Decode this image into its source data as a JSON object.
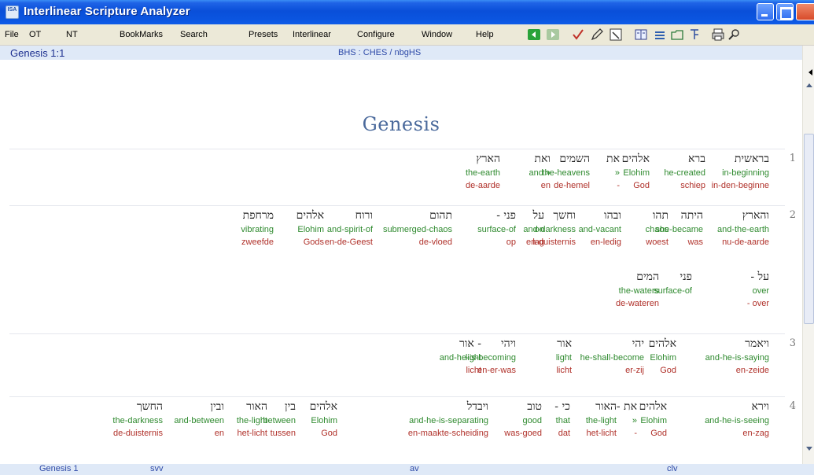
{
  "window": {
    "title": "Interlinear Scripture Analyzer",
    "icon_text": "ISA",
    "controls": [
      "minimize",
      "maximize",
      "close"
    ]
  },
  "menu": [
    "File",
    "OT",
    "NT",
    "BookMarks",
    "Search",
    "Presets",
    "Interlinear",
    "Configure",
    "Window",
    "Help"
  ],
  "toolbar_icons": [
    "back-arrow-icon",
    "forward-arrow-icon",
    "checkmark-icon",
    "pen-icon",
    "edit-page-icon",
    "columns-icon",
    "list-icon",
    "folder-icon",
    "tree-icon",
    "print-icon",
    "search-icon"
  ],
  "header": {
    "reference": "Genesis 1:1",
    "texts": "BHS : CHES / nbgHS"
  },
  "book_title": "Genesis",
  "verses": [
    {
      "num": "1",
      "lines": [
        [
          {
            "heb": "בראשית",
            "eng": "in-beginning",
            "dut": "in-den-beginne"
          },
          {
            "heb": "ברא",
            "eng": "he-created",
            "dut": "schiep"
          },
          {
            "heb": "אלהים",
            "eng": "Elohim",
            "dut": "God"
          },
          {
            "heb": "את",
            "eng": "»",
            "dut": "-"
          },
          {
            "heb": "השמים",
            "eng": "the-heavens",
            "dut": "de-hemel"
          },
          {
            "heb": "ואת",
            "eng": "and »",
            "dut": "en"
          },
          {
            "heb": "הארץ",
            "eng": "the-earth",
            "dut": "de-aarde"
          }
        ]
      ]
    },
    {
      "num": "2",
      "lines": [
        [
          {
            "heb": "והארץ",
            "eng": "and-the-earth",
            "dut": "nu-de-aarde"
          },
          {
            "heb": "היתה",
            "eng": "she-became",
            "dut": "was"
          },
          {
            "heb": "תהו",
            "eng": "chaos",
            "dut": "woest"
          },
          {
            "heb": "ובהו",
            "eng": "and-vacant",
            "dut": "en-ledig"
          },
          {
            "heb": "וחשך",
            "eng": "and-darkness",
            "dut": "en-duisternis"
          },
          {
            "heb": "על",
            "eng": "on",
            "dut": "lag"
          },
          {
            "heb": "פני -",
            "eng": "surface-of",
            "dut": "op"
          },
          {
            "heb": "תהום",
            "eng": "submerged-chaos",
            "dut": "de-vloed"
          },
          {
            "heb": "ורוח",
            "eng": "and-spirit-of",
            "dut": "en-de-Geest"
          },
          {
            "heb": "אלהים",
            "eng": "Elohim",
            "dut": "Gods"
          },
          {
            "heb": "מרחפת",
            "eng": "vibrating",
            "dut": "zweefde"
          }
        ],
        [
          {
            "heb": "על -",
            "eng": "over",
            "dut": "- over"
          },
          {
            "heb": "פני",
            "eng": "surface-of",
            "dut": ""
          },
          {
            "heb": "המים",
            "eng": "the-waters",
            "dut": "de-wateren"
          }
        ]
      ]
    },
    {
      "num": "3",
      "lines": [
        [
          {
            "heb": "ויאמר",
            "eng": "and-he-is-saying",
            "dut": "en-zeide"
          },
          {
            "heb": "אלהים",
            "eng": "Elohim",
            "dut": "God"
          },
          {
            "heb": "יהי",
            "eng": "he-shall-become",
            "dut": "er-zij"
          },
          {
            "heb": "אור",
            "eng": "light",
            "dut": "licht"
          },
          {
            "heb": "ויהי",
            "eng": "and-he-is-becoming",
            "dut": "en-er-was"
          },
          {
            "heb": "- אור",
            "eng": "light",
            "dut": "licht"
          }
        ]
      ]
    },
    {
      "num": "4",
      "lines": [
        [
          {
            "heb": "וירא",
            "eng": "and-he-is-seeing",
            "dut": "en-zag"
          },
          {
            "heb": "אלהים",
            "eng": "Elohim",
            "dut": "God"
          },
          {
            "heb": "את -",
            "eng": "»",
            "dut": "-"
          },
          {
            "heb": "האור",
            "eng": "the-light",
            "dut": "het-licht"
          },
          {
            "heb": "כי -",
            "eng": "that",
            "dut": "dat"
          },
          {
            "heb": "טוב",
            "eng": "good",
            "dut": "was-goed"
          },
          {
            "heb": "ויבדל",
            "eng": "and-he-is-separating",
            "dut": "en-maakte-scheiding"
          },
          {
            "heb": "אלהים",
            "eng": "Elohim",
            "dut": "God"
          },
          {
            "heb": "בין",
            "eng": "between",
            "dut": "tussen"
          },
          {
            "heb": "האור",
            "eng": "the-light",
            "dut": "het-licht"
          },
          {
            "heb": "ובין",
            "eng": "and-between",
            "dut": "en"
          },
          {
            "heb": "החשך",
            "eng": "the-darkness",
            "dut": "de-duisternis"
          }
        ]
      ]
    }
  ],
  "status": [
    "Genesis 1",
    "svv",
    "av",
    "clv"
  ],
  "colors": {
    "title_bar": "#0a4fd9",
    "hebrew": "#202020",
    "english": "#2f8a2f",
    "dutch": "#b0312a",
    "book_title": "#4b6a9c",
    "header_bg": "#dfe9f7"
  }
}
